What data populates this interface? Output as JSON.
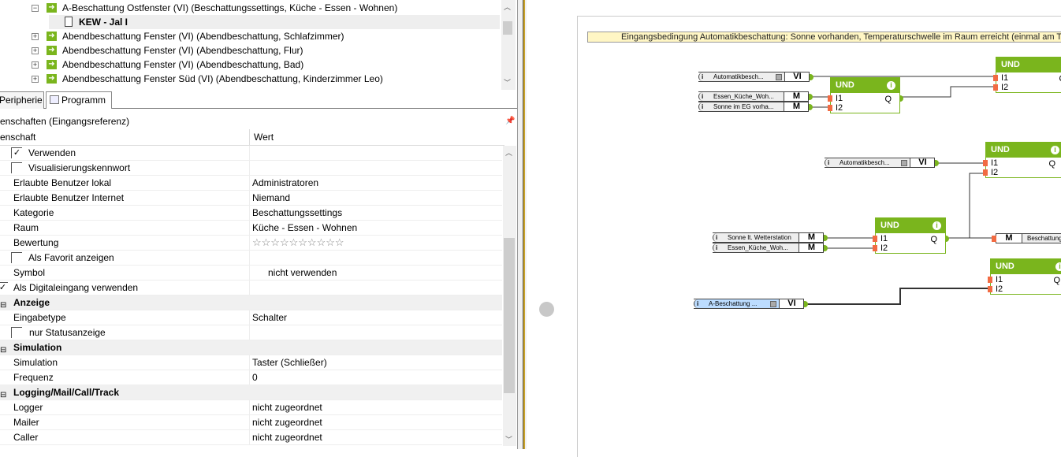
{
  "tree": {
    "items": [
      {
        "label": "A-Beschattung Ostfenster (VI) (Beschattungssettings, Küche - Essen - Wohnen)",
        "expanded": true
      },
      {
        "label": "KEW - Jal I",
        "selected": true
      },
      {
        "label": "Abendbeschattung Fenster (VI) (Abendbeschattung, Schlafzimmer)"
      },
      {
        "label": "Abendbeschattung Fenster (VI) (Abendbeschattung, Flur)"
      },
      {
        "label": "Abendbeschattung Fenster (VI) (Abendbeschattung, Bad)"
      },
      {
        "label": "Abendbeschattung Fenster Süd (VI) (Abendbeschattung, Kinderzimmer Leo)"
      }
    ]
  },
  "tabs": [
    {
      "label": "Peripherie"
    },
    {
      "label": "Programm"
    }
  ],
  "properties": {
    "title": "enschaften (Eingangsreferenz)",
    "col_name": "enschaft",
    "col_value": "Wert",
    "rows": [
      {
        "name": "Verwenden",
        "value": "",
        "checkbox": true,
        "checked": true
      },
      {
        "name": "Visualisierungskennwort",
        "value": "",
        "checkbox": true,
        "checked": false
      },
      {
        "name": "Erlaubte Benutzer lokal",
        "value": "Administratoren"
      },
      {
        "name": "Erlaubte Benutzer Internet",
        "value": "Niemand"
      },
      {
        "name": "Kategorie",
        "value": "Beschattungssettings"
      },
      {
        "name": "Raum",
        "value": "Küche - Essen - Wohnen"
      },
      {
        "name": "Bewertung",
        "value": "☆☆☆☆☆☆☆☆☆☆",
        "rating": 0,
        "rating_max": 10
      },
      {
        "name": "Als Favorit anzeigen",
        "value": "",
        "checkbox": true,
        "checked": false
      },
      {
        "name": "Symbol",
        "value": "nicht verwenden"
      },
      {
        "name": "Als Digitaleingang verwenden",
        "value": "",
        "checked": true
      },
      {
        "name": "Anzeige",
        "category": true
      },
      {
        "name": "Eingabetype",
        "value": "Schalter"
      },
      {
        "name": "nur Statusanzeige",
        "value": "",
        "checkbox": true,
        "checked": false
      },
      {
        "name": "Simulation",
        "category": true
      },
      {
        "name": "Simulation",
        "value": "Taster (Schließer)"
      },
      {
        "name": "Frequenz",
        "value": "0"
      },
      {
        "name": "Logging/Mail/Call/Track",
        "category": true
      },
      {
        "name": "Logger",
        "value": "nicht zugeordnet"
      },
      {
        "name": "Mailer",
        "value": "nicht zugeordnet"
      },
      {
        "name": "Caller",
        "value": "nicht zugeordnet"
      }
    ]
  },
  "canvas": {
    "comment": "Eingangsbedingung Automatikbeschattung: Sonne vorhanden, Temperaturschwelle im Raum erreicht (einmal am Tag)",
    "block_title": "UND",
    "pin_i1": "I1",
    "pin_i2": "I2",
    "pin_q": "Q",
    "info": "i",
    "inputs": [
      {
        "label": "Automatikbesch...",
        "type": "VI"
      },
      {
        "label": "Essen_Küche_Woh...",
        "type": "M"
      },
      {
        "label": "Sonne im EG vorha...",
        "type": "M"
      },
      {
        "label": "Automatikbesch...",
        "type": "VI"
      },
      {
        "label": "Sonne lt. Wetterstation",
        "type": "M"
      },
      {
        "label": "Essen_Küche_Woh...",
        "type": "M"
      },
      {
        "label": "A-Beschattung ...",
        "type": "VI"
      }
    ],
    "output": {
      "label": "Beschattung",
      "type": "M"
    },
    "colors": {
      "block": "#7ab51d",
      "pin": "#f26b43",
      "comment": "#fff6c4"
    }
  }
}
